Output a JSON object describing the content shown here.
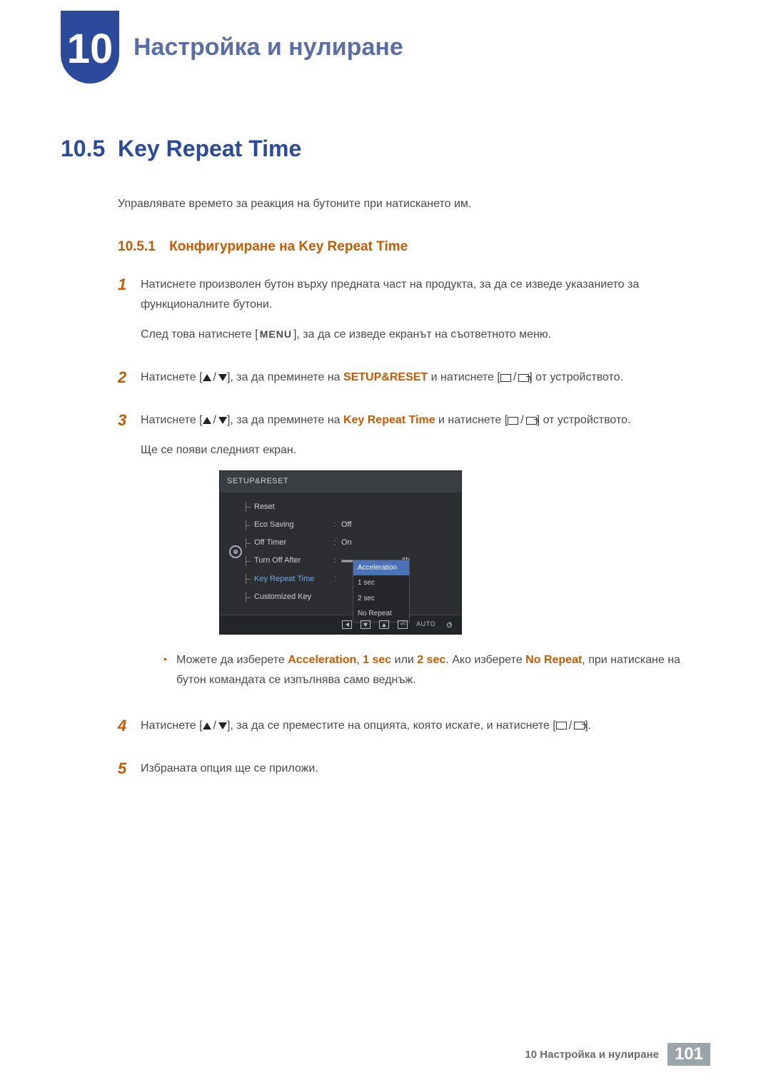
{
  "chapter": {
    "number": "10",
    "title": "Настройка и нулиране"
  },
  "section": {
    "number": "10.5",
    "title": "Key Repeat Time"
  },
  "intro": "Управлявате времето за реакция на бутоните при натискането им.",
  "subsection": {
    "number": "10.5.1",
    "title": "Конфигуриране на Key Repeat Time"
  },
  "steps": {
    "s1a": "Натиснете произволен бутон върху предната част на продукта, за да се изведе указанието за функционалните бутони.",
    "s1b_pre": "След това натиснете [",
    "s1b_menu": "MENU",
    "s1b_post": "], за да се изведе екранът на съответното меню.",
    "s2_pre": "Натиснете [",
    "s2_mid": "], за да преминете на ",
    "s2_kw": "SETUP&RESET",
    "s2_mid2": " и натиснете [",
    "s2_post": "] от устройството.",
    "s3_pre": "Натиснете [",
    "s3_mid": "], за да преминете на ",
    "s3_kw": "Key Repeat Time",
    "s3_mid2": " и натиснете [",
    "s3_post": "] от устройството.",
    "s3_tail": "Ще се появи следният екран.",
    "bullet_pre": "Можете да изберете ",
    "bullet_a": "Acceleration",
    "bullet_comma": ", ",
    "bullet_b": "1 sec",
    "bullet_or": " или ",
    "bullet_c": "2 sec",
    "bullet_mid": ". Ако изберете ",
    "bullet_d": "No Repeat",
    "bullet_tail": ", при натискане на бутон командата се изпълнява само веднъж.",
    "s4_pre": "Натиснете [",
    "s4_mid": "], за да се преместите на опцията, която искате, и натиснете [",
    "s4_post": "].",
    "s5": "Избраната опция ще се приложи."
  },
  "step_nums": {
    "n1": "1",
    "n2": "2",
    "n3": "3",
    "n4": "4",
    "n5": "5"
  },
  "osd": {
    "title": "SETUP&RESET",
    "rows": {
      "reset": "Reset",
      "eco": "Eco Saving",
      "eco_val": "Off",
      "offtimer": "Off Timer",
      "offtimer_val": "On",
      "turnoff": "Turn Off After",
      "turnoff_val": "4h",
      "krt": "Key Repeat Time",
      "custom": "Customized Key"
    },
    "dropdown": {
      "o1": "Acceleration",
      "o2": "1 sec",
      "o3": "2 sec",
      "o4": "No Repeat"
    },
    "auto": "AUTO"
  },
  "footer": {
    "text": "10 Настройка и нулиране",
    "page": "101"
  }
}
